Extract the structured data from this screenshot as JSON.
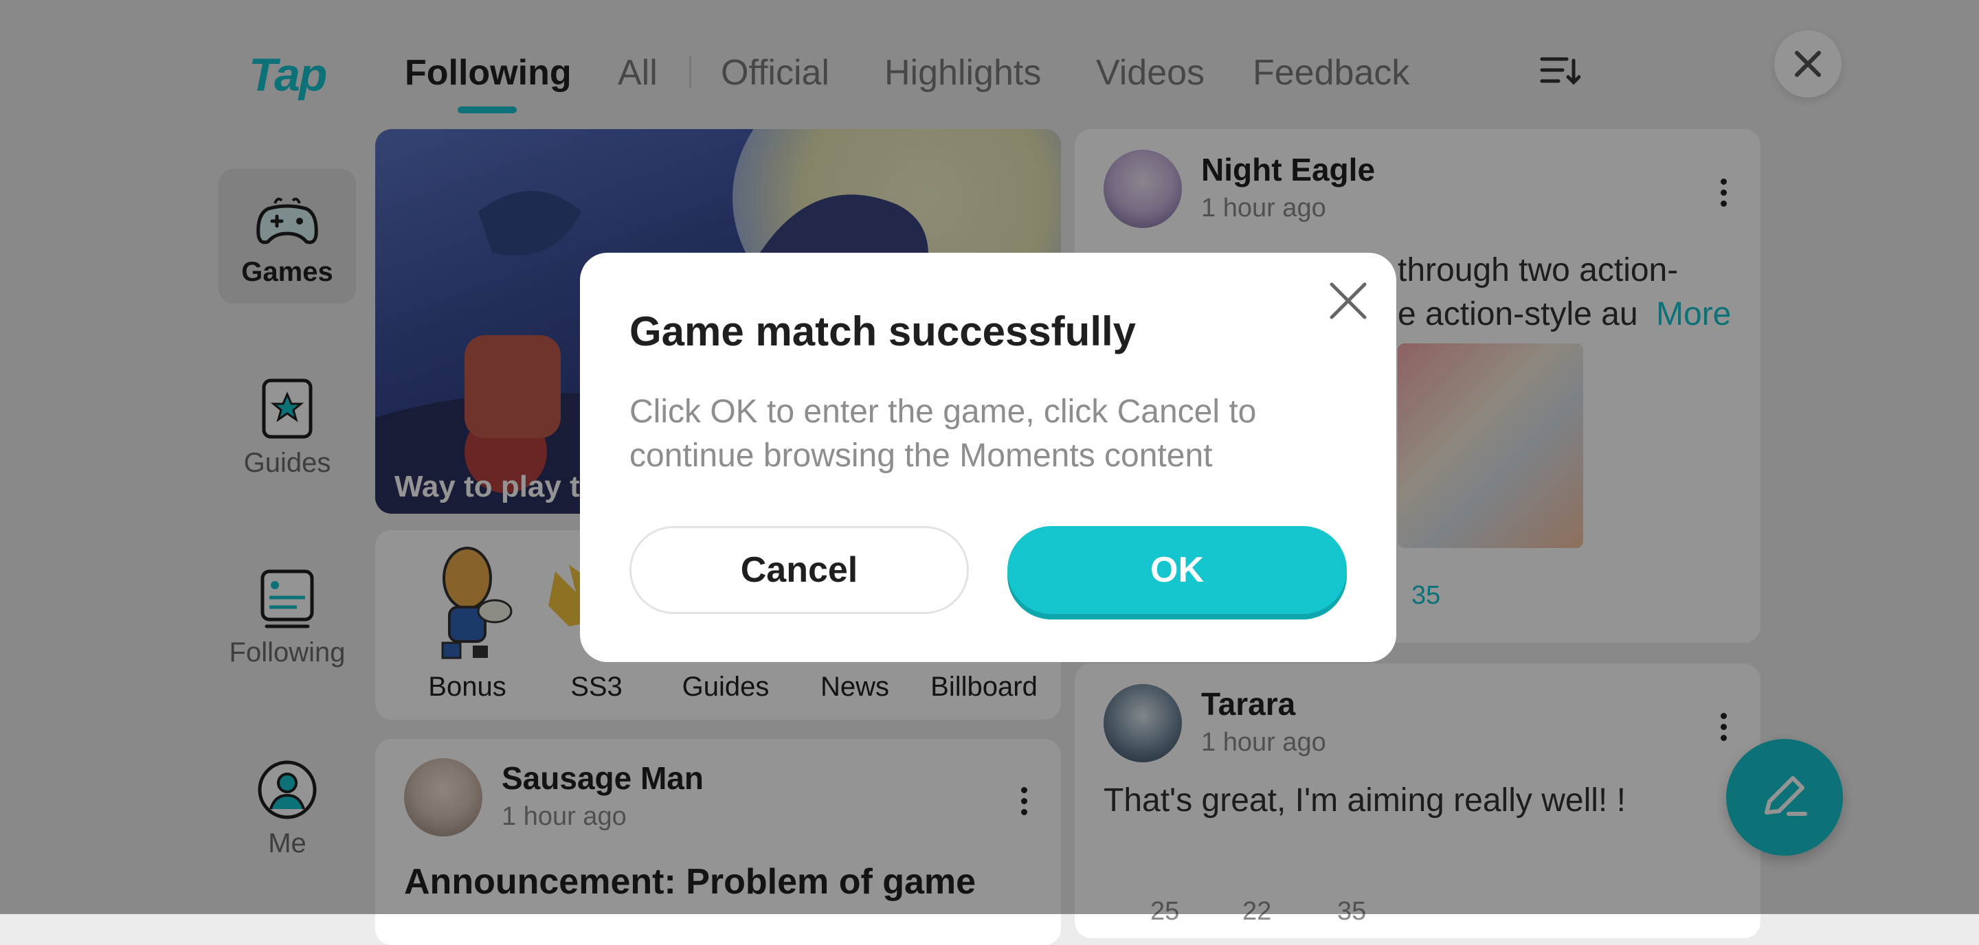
{
  "app": {
    "logo": "Tap"
  },
  "tabs": [
    {
      "label": "Following",
      "active": true
    },
    {
      "label": "All"
    },
    {
      "label": "Official"
    },
    {
      "label": "Highlights"
    },
    {
      "label": "Videos"
    },
    {
      "label": "Feedback"
    }
  ],
  "sidebar": {
    "items": [
      {
        "label": "Games",
        "icon": "gamepad-icon",
        "active": true
      },
      {
        "label": "Guides",
        "icon": "star-card-icon"
      },
      {
        "label": "Following",
        "icon": "feed-icon"
      },
      {
        "label": "Me",
        "icon": "user-icon"
      }
    ]
  },
  "banner": {
    "caption": "Way to play t"
  },
  "quick_links": [
    "Bonus",
    "SS3",
    "Guides",
    "News",
    "Billboard"
  ],
  "posts": [
    {
      "name": "Sausage Man",
      "time": "1 hour ago",
      "title": "Announcement: Problem of game"
    },
    {
      "name": "Night Eagle",
      "time": "1 hour ago",
      "line1": "through two action-",
      "line2": "e action-style au",
      "more": "More",
      "likes": "35"
    },
    {
      "name": "Tarara",
      "time": "1 hour ago",
      "text": "That's great, I'm aiming really well! !",
      "stats": [
        "25",
        "22",
        "35"
      ]
    }
  ],
  "dialog": {
    "title": "Game match successfully",
    "body": "Click OK to enter the game, click Cancel to continue browsing the Moments content",
    "cancel_label": "Cancel",
    "ok_label": "OK"
  },
  "colors": {
    "accent": "#15c5ce",
    "overlay": "rgba(0,0,0,0.42)"
  }
}
